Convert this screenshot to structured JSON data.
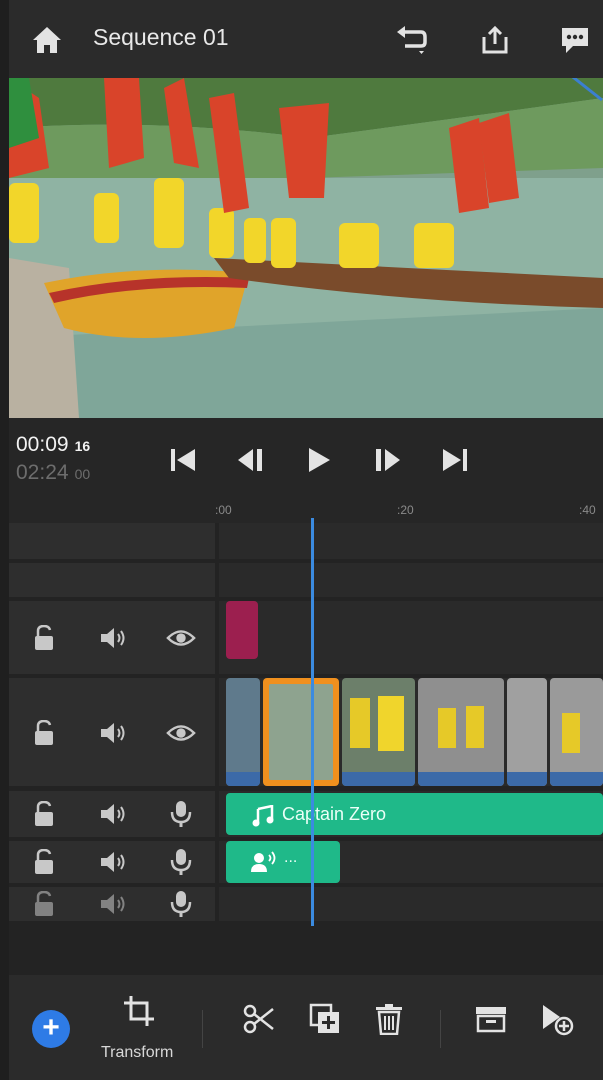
{
  "header": {
    "title": "Sequence 01",
    "icons": [
      "home-icon",
      "undo-icon",
      "share-icon",
      "feedback-icon"
    ]
  },
  "transport": {
    "current_time": "00:09",
    "current_frames": "16",
    "total_time": "02:24",
    "total_frames": "00",
    "controls": [
      "skip-to-start",
      "step-back",
      "play",
      "step-forward",
      "skip-to-end"
    ]
  },
  "ruler": {
    "ticks": [
      ":00",
      ":20",
      ":40"
    ]
  },
  "tracks": {
    "audio_clip_title": "Captain Zero",
    "voiceover_label": "..."
  },
  "toolbar": {
    "transform_label": "Transform"
  },
  "colors": {
    "accent": "#2e7be6",
    "audio": "#1fb989",
    "selected_clip": "#f0901e",
    "title_clip": "#9c1f4f"
  }
}
